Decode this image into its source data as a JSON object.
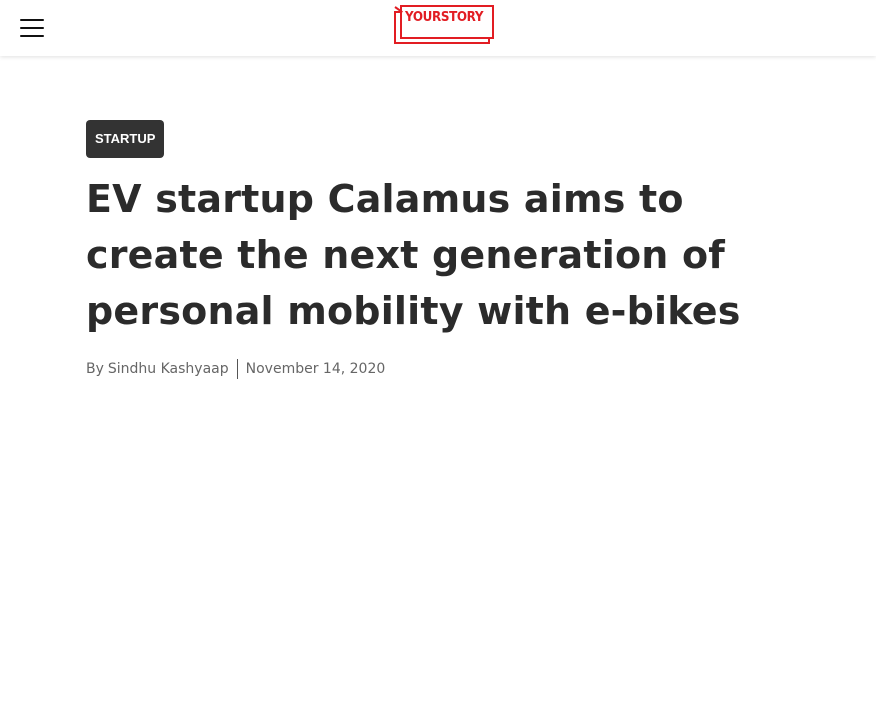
{
  "header": {
    "menu_icon": "hamburger-menu-icon",
    "logo_text": "YOURSTORY",
    "logo_color": "#e21d23"
  },
  "article": {
    "category": "STARTUP",
    "title": "EV startup Calamus aims to create the next generation of personal mobility with e-bikes",
    "byline_prefix": "By",
    "author": "Sindhu Kashyaap",
    "date": "November 14, 2020"
  },
  "colors": {
    "category_bg": "#333333",
    "headline": "#2b2b2b",
    "meta_text": "#666666"
  }
}
